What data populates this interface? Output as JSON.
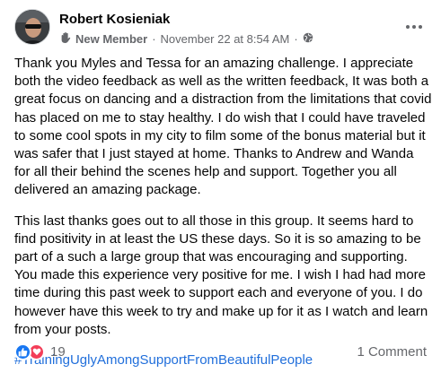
{
  "post": {
    "author_name": "Robert Kosieniak",
    "badge_label": "New Member",
    "separator": "·",
    "timestamp": "November 22 at 8:54 AM",
    "paragraphs": [
      "Thank you Myles and Tessa for an amazing challenge.  I appreciate both the video feedback as well as the written feedback,   It was both a great focus on dancing and a distraction from the limitations that covid has placed on me to stay healthy.   I do wish that I could have traveled to some cool spots in my city to film some of the bonus material but it was safer that I just stayed at home.  Thanks to Andrew and Wanda for all their behind the scenes help and support.  Together you all delivered an amazing package.",
      "This last thanks goes out to all those in this group.  It seems hard to find positivity in at least the US these days.  So it is so amazing to be part of a such a large group that was encouraging and supporting.  You made this experience very positive for me.  I wish I had had more time during this past week to support each and everyone of you.  I do however have this week to try and make up for it as I watch and learn from your posts."
    ],
    "hashtag": "#TrainingUglyAmongSupportFromBeautifulPeople",
    "reaction_count": "19",
    "comments_label": "1 Comment"
  },
  "icons": {
    "badge": "new-member-hand-icon",
    "privacy": "globe-icon",
    "more": "more-options-icon",
    "like": "like-reaction-icon",
    "love": "love-reaction-icon"
  },
  "colors": {
    "hashtag": "#216fdb",
    "like": "#1877f2",
    "love": "#f33e58",
    "secondary_text": "#65676b"
  }
}
